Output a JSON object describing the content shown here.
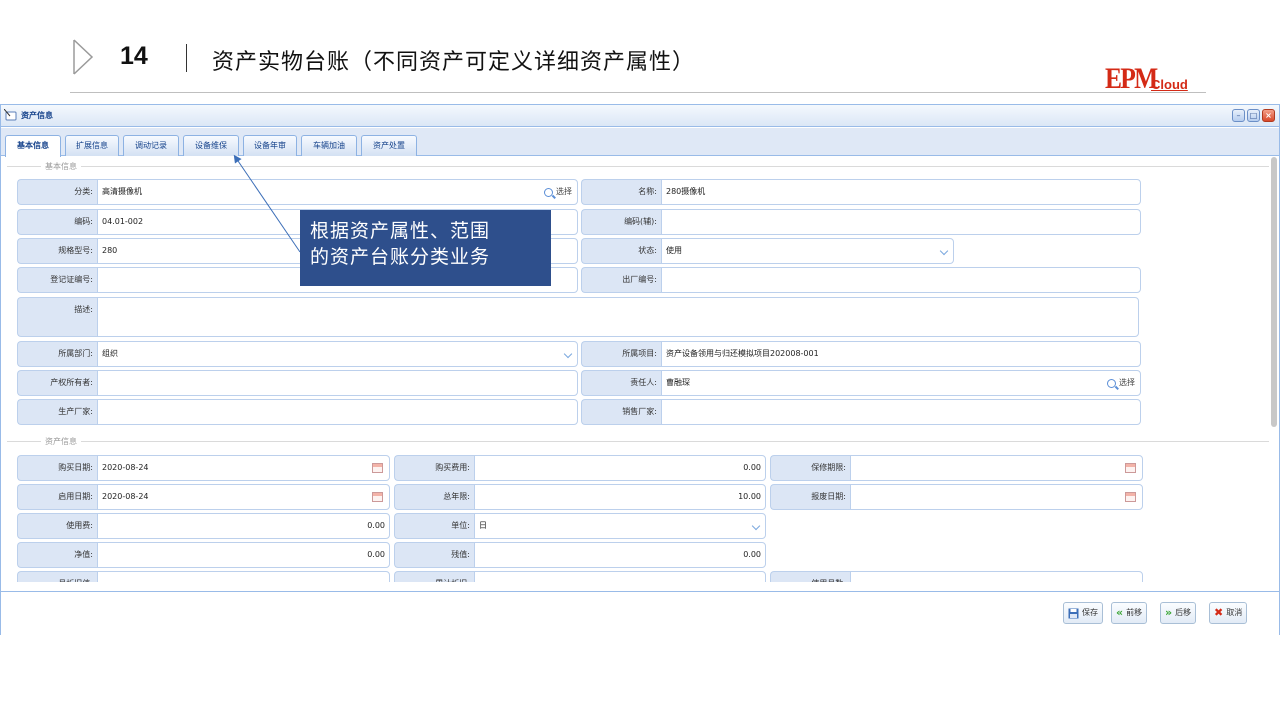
{
  "slide": {
    "number": "14",
    "title": "资产实物台账（不同资产可定义详细资产属性）",
    "logo_main": "EPM",
    "logo_sub": "Cloud"
  },
  "window": {
    "title": "资产信息",
    "buttons": {
      "minimize": "–",
      "maximize": "□",
      "close": "×"
    }
  },
  "tabs": [
    {
      "label": "基本信息",
      "active": true
    },
    {
      "label": "扩展信息",
      "active": false
    },
    {
      "label": "调动记录",
      "active": false
    },
    {
      "label": "设备维保",
      "active": false
    },
    {
      "label": "设备年审",
      "active": false
    },
    {
      "label": "车辆加油",
      "active": false
    },
    {
      "label": "资产处置",
      "active": false
    }
  ],
  "sections": {
    "basic": "基本信息",
    "asset": "资产信息"
  },
  "basic_fields": {
    "category": {
      "label": "分类:",
      "value": "高清摄像机",
      "button": "选择"
    },
    "name": {
      "label": "名称:",
      "value": "280摄像机"
    },
    "code": {
      "label": "编码:",
      "value": "04.01-002"
    },
    "aux_code": {
      "label": "编码(辅):",
      "value": ""
    },
    "model": {
      "label": "规格型号:",
      "value": "280"
    },
    "status": {
      "label": "状态:",
      "value": "使用"
    },
    "reg_cert": {
      "label": "登记证编号:",
      "value": ""
    },
    "factory_no": {
      "label": "出厂编号:",
      "value": ""
    },
    "description": {
      "label": "描述:",
      "value": ""
    },
    "department": {
      "label": "所属部门:",
      "value": "组织"
    },
    "project": {
      "label": "所属项目:",
      "value": "资产设备领用与归还模拟项目202008-001"
    },
    "owner": {
      "label": "产权所有者:",
      "value": ""
    },
    "responsible": {
      "label": "责任人:",
      "value": "曹融琛",
      "button": "选择"
    },
    "manufacturer": {
      "label": "生产厂家:",
      "value": ""
    },
    "seller": {
      "label": "销售厂家:",
      "value": ""
    }
  },
  "asset_fields": {
    "purchase_date": {
      "label": "购买日期:",
      "value": "2020-08-24"
    },
    "purchase_cost": {
      "label": "购买费用:",
      "value": "0.00"
    },
    "warranty": {
      "label": "保修期限:",
      "value": ""
    },
    "start_date": {
      "label": "启用日期:",
      "value": "2020-08-24"
    },
    "total_years": {
      "label": "总年限:",
      "value": "10.00"
    },
    "scrap_date": {
      "label": "报废日期:",
      "value": ""
    },
    "usage_fee": {
      "label": "使用费:",
      "value": "0.00"
    },
    "unit": {
      "label": "单位:",
      "value": "日"
    },
    "net_value": {
      "label": "净值:",
      "value": "0.00"
    },
    "residual": {
      "label": "残值:",
      "value": "0.00"
    },
    "monthly_dep": {
      "label": "月折旧值:",
      "value": ""
    },
    "accum_dep": {
      "label": "累计折旧:",
      "value": ""
    },
    "months_used": {
      "label": "使用月数:",
      "value": ""
    }
  },
  "footer_buttons": {
    "save": "保存",
    "prev": "前移",
    "next": "后移",
    "cancel": "取消"
  },
  "callout": {
    "line1": "根据资产属性、范围",
    "line2": "的资产台账分类业务"
  },
  "colors": {
    "accent": "#15428b",
    "label_bg": "#dce6f5",
    "callout_bg": "#2e4f8c",
    "logo": "#d42a16"
  }
}
